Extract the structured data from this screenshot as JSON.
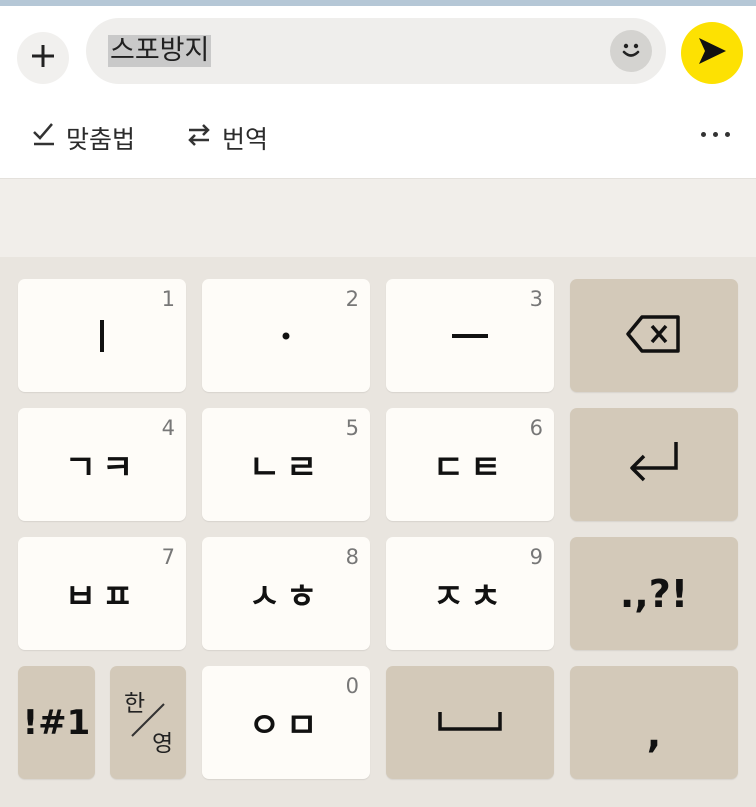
{
  "input": {
    "typed_text": "스포방지",
    "add_icon": "plus-icon",
    "emoji_icon": "smiley-icon",
    "send_icon": "send-icon"
  },
  "toolbar": {
    "spellcheck_label": "맞춤법",
    "translate_label": "번역",
    "more_icon": "more-horizontal-icon"
  },
  "keyboard": {
    "row1": [
      {
        "label": "ㅣ",
        "number": "1"
      },
      {
        "label": "·",
        "number": "2"
      },
      {
        "label": "ㅡ",
        "number": "3"
      },
      {
        "label": "backspace"
      }
    ],
    "row2": [
      {
        "label": "ㄱㅋ",
        "number": "4"
      },
      {
        "label": "ㄴㄹ",
        "number": "5"
      },
      {
        "label": "ㄷㅌ",
        "number": "6"
      },
      {
        "label": "enter"
      }
    ],
    "row3": [
      {
        "label": "ㅂㅍ",
        "number": "7"
      },
      {
        "label": "ㅅㅎ",
        "number": "8"
      },
      {
        "label": "ㅈㅊ",
        "number": "9"
      },
      {
        "label": ".,?!"
      }
    ],
    "row4": {
      "symbols_label": "!#1",
      "han_label": "한",
      "yeong_label": "영",
      "zero_label": "ㅇㅁ",
      "zero_number": "0",
      "space_icon": "space-icon",
      "comma_label": ","
    }
  },
  "colors": {
    "send": "#fde102",
    "key_light": "#fefcf8",
    "key_dark": "#d3c9b9",
    "keyboard_bg": "#e9e5df"
  }
}
